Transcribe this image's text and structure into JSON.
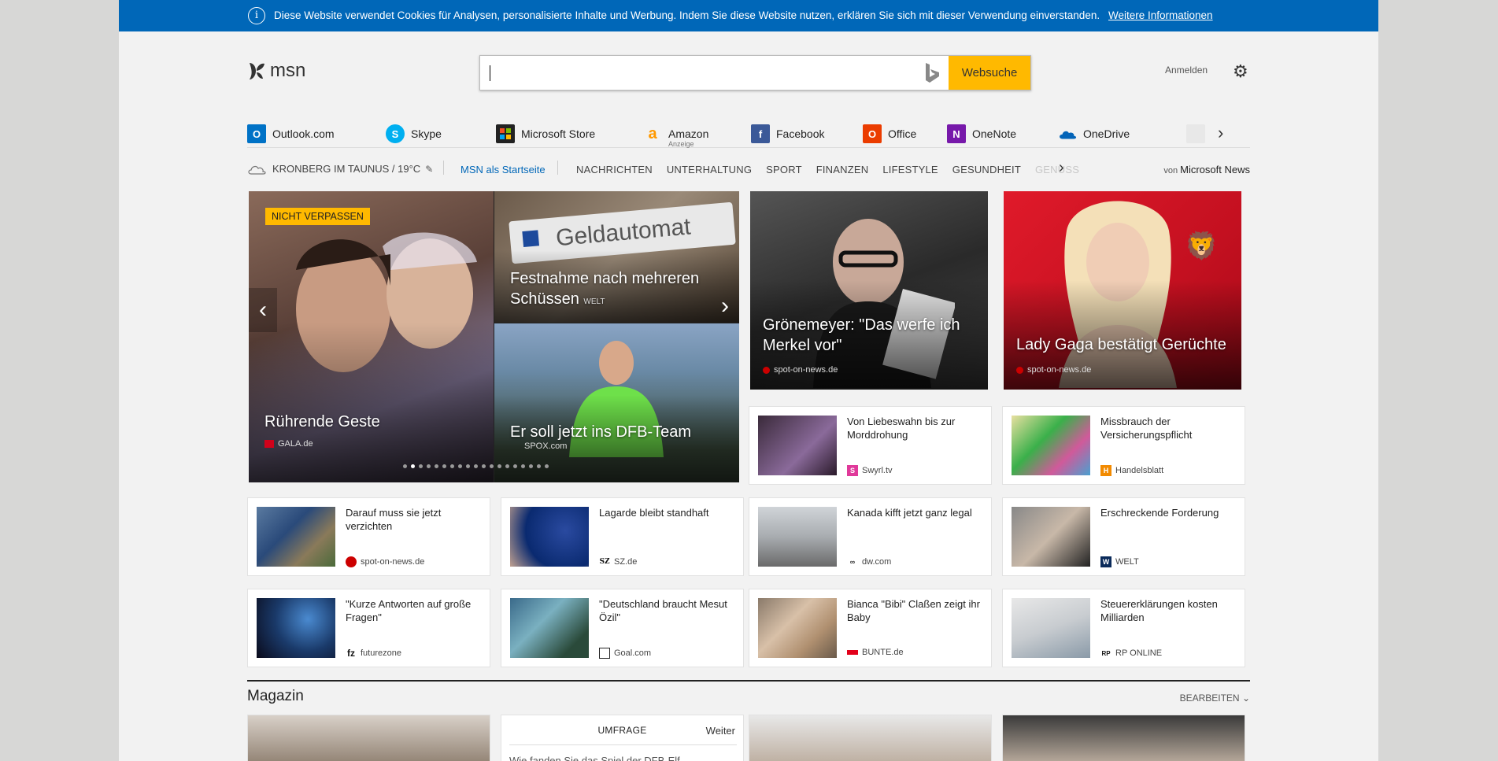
{
  "cookie_bar": {
    "message": "Diese Website verwendet Cookies für Analysen, personalisierte Inhalte und Werbung. Indem Sie diese Website nutzen, erklären Sie sich mit dieser Verwendung einverstanden.",
    "link": "Weitere Informationen",
    "info_icon": "info-icon"
  },
  "header": {
    "logo_text": "msn",
    "search_placeholder": "",
    "search_button": "Websuche",
    "signin": "Anmelden",
    "brand_color": "#0067b8",
    "accent_color": "#ffb900"
  },
  "quicklinks": [
    {
      "label": "Outlook.com",
      "icon": "outlook-icon"
    },
    {
      "label": "Skype",
      "icon": "skype-icon"
    },
    {
      "label": "Microsoft Store",
      "icon": "store-icon"
    },
    {
      "label": "Amazon",
      "sub": "Anzeige",
      "icon": "amazon-icon"
    },
    {
      "label": "Facebook",
      "icon": "facebook-icon"
    },
    {
      "label": "Office",
      "icon": "office-icon"
    },
    {
      "label": "OneNote",
      "icon": "onenote-icon"
    },
    {
      "label": "OneDrive",
      "icon": "onedrive-icon"
    }
  ],
  "nav": {
    "weather": "KRONBERG IM TAUNUS / 19°C",
    "home": "MSN als Startseite",
    "categories": [
      "NACHRICHTEN",
      "UNTERHALTUNG",
      "SPORT",
      "FINANZEN",
      "LIFESTYLE",
      "GESUNDHEIT",
      "GENUSS"
    ],
    "by_prefix": "von",
    "by_brand": "Microsoft News"
  },
  "hero": {
    "badge": "NICHT VERPASSEN",
    "main_title": "Rührende Geste",
    "main_source": "GALA.de",
    "top_right_title": "Festnahme nach mehreren Schüssen",
    "top_right_source": "WELT",
    "top_right_sign": "Geldautomat",
    "bottom_right_title": "Er soll jetzt ins DFB-Team",
    "bottom_right_source": "SPOX.com",
    "slide_count": 19,
    "active_slide": 1
  },
  "big_tiles": [
    {
      "title": "Grönemeyer: \"Das werfe ich Merkel vor\"",
      "source": "spot-on-news.de"
    },
    {
      "title": "Lady Gaga bestätigt Gerüchte",
      "source": "spot-on-news.de"
    }
  ],
  "cards_row1": [
    {
      "title": "Von Liebeswahn bis zur Morddrohung",
      "source": "Swyrl.tv"
    },
    {
      "title": "Missbrauch der Versicherungspflicht",
      "source": "Handelsblatt"
    }
  ],
  "cards_row2": [
    {
      "title": "Darauf muss sie jetzt verzichten",
      "source": "spot-on-news.de"
    },
    {
      "title": "Lagarde bleibt standhaft",
      "source": "SZ.de"
    },
    {
      "title": "Kanada kifft jetzt ganz legal",
      "source": "dw.com"
    },
    {
      "title": "Erschreckende Forderung",
      "source": "WELT"
    }
  ],
  "cards_row3": [
    {
      "title": "\"Kurze Antworten auf große Fragen\"",
      "source": "futurezone"
    },
    {
      "title": "\"Deutschland braucht Mesut Özil\"",
      "source": "Goal.com"
    },
    {
      "title": "Bianca \"Bibi\" Claßen zeigt ihr Baby",
      "source": "BUNTE.de"
    },
    {
      "title": "Steuererklärungen kosten Milliarden",
      "source": "RP ONLINE"
    }
  ],
  "magazin": {
    "title": "Magazin",
    "edit": "BEARBEITEN",
    "poll_head": "UMFRAGE",
    "poll_next": "Weiter",
    "poll_question": "Wie fanden Sie das Spiel der DFB-Elf"
  }
}
